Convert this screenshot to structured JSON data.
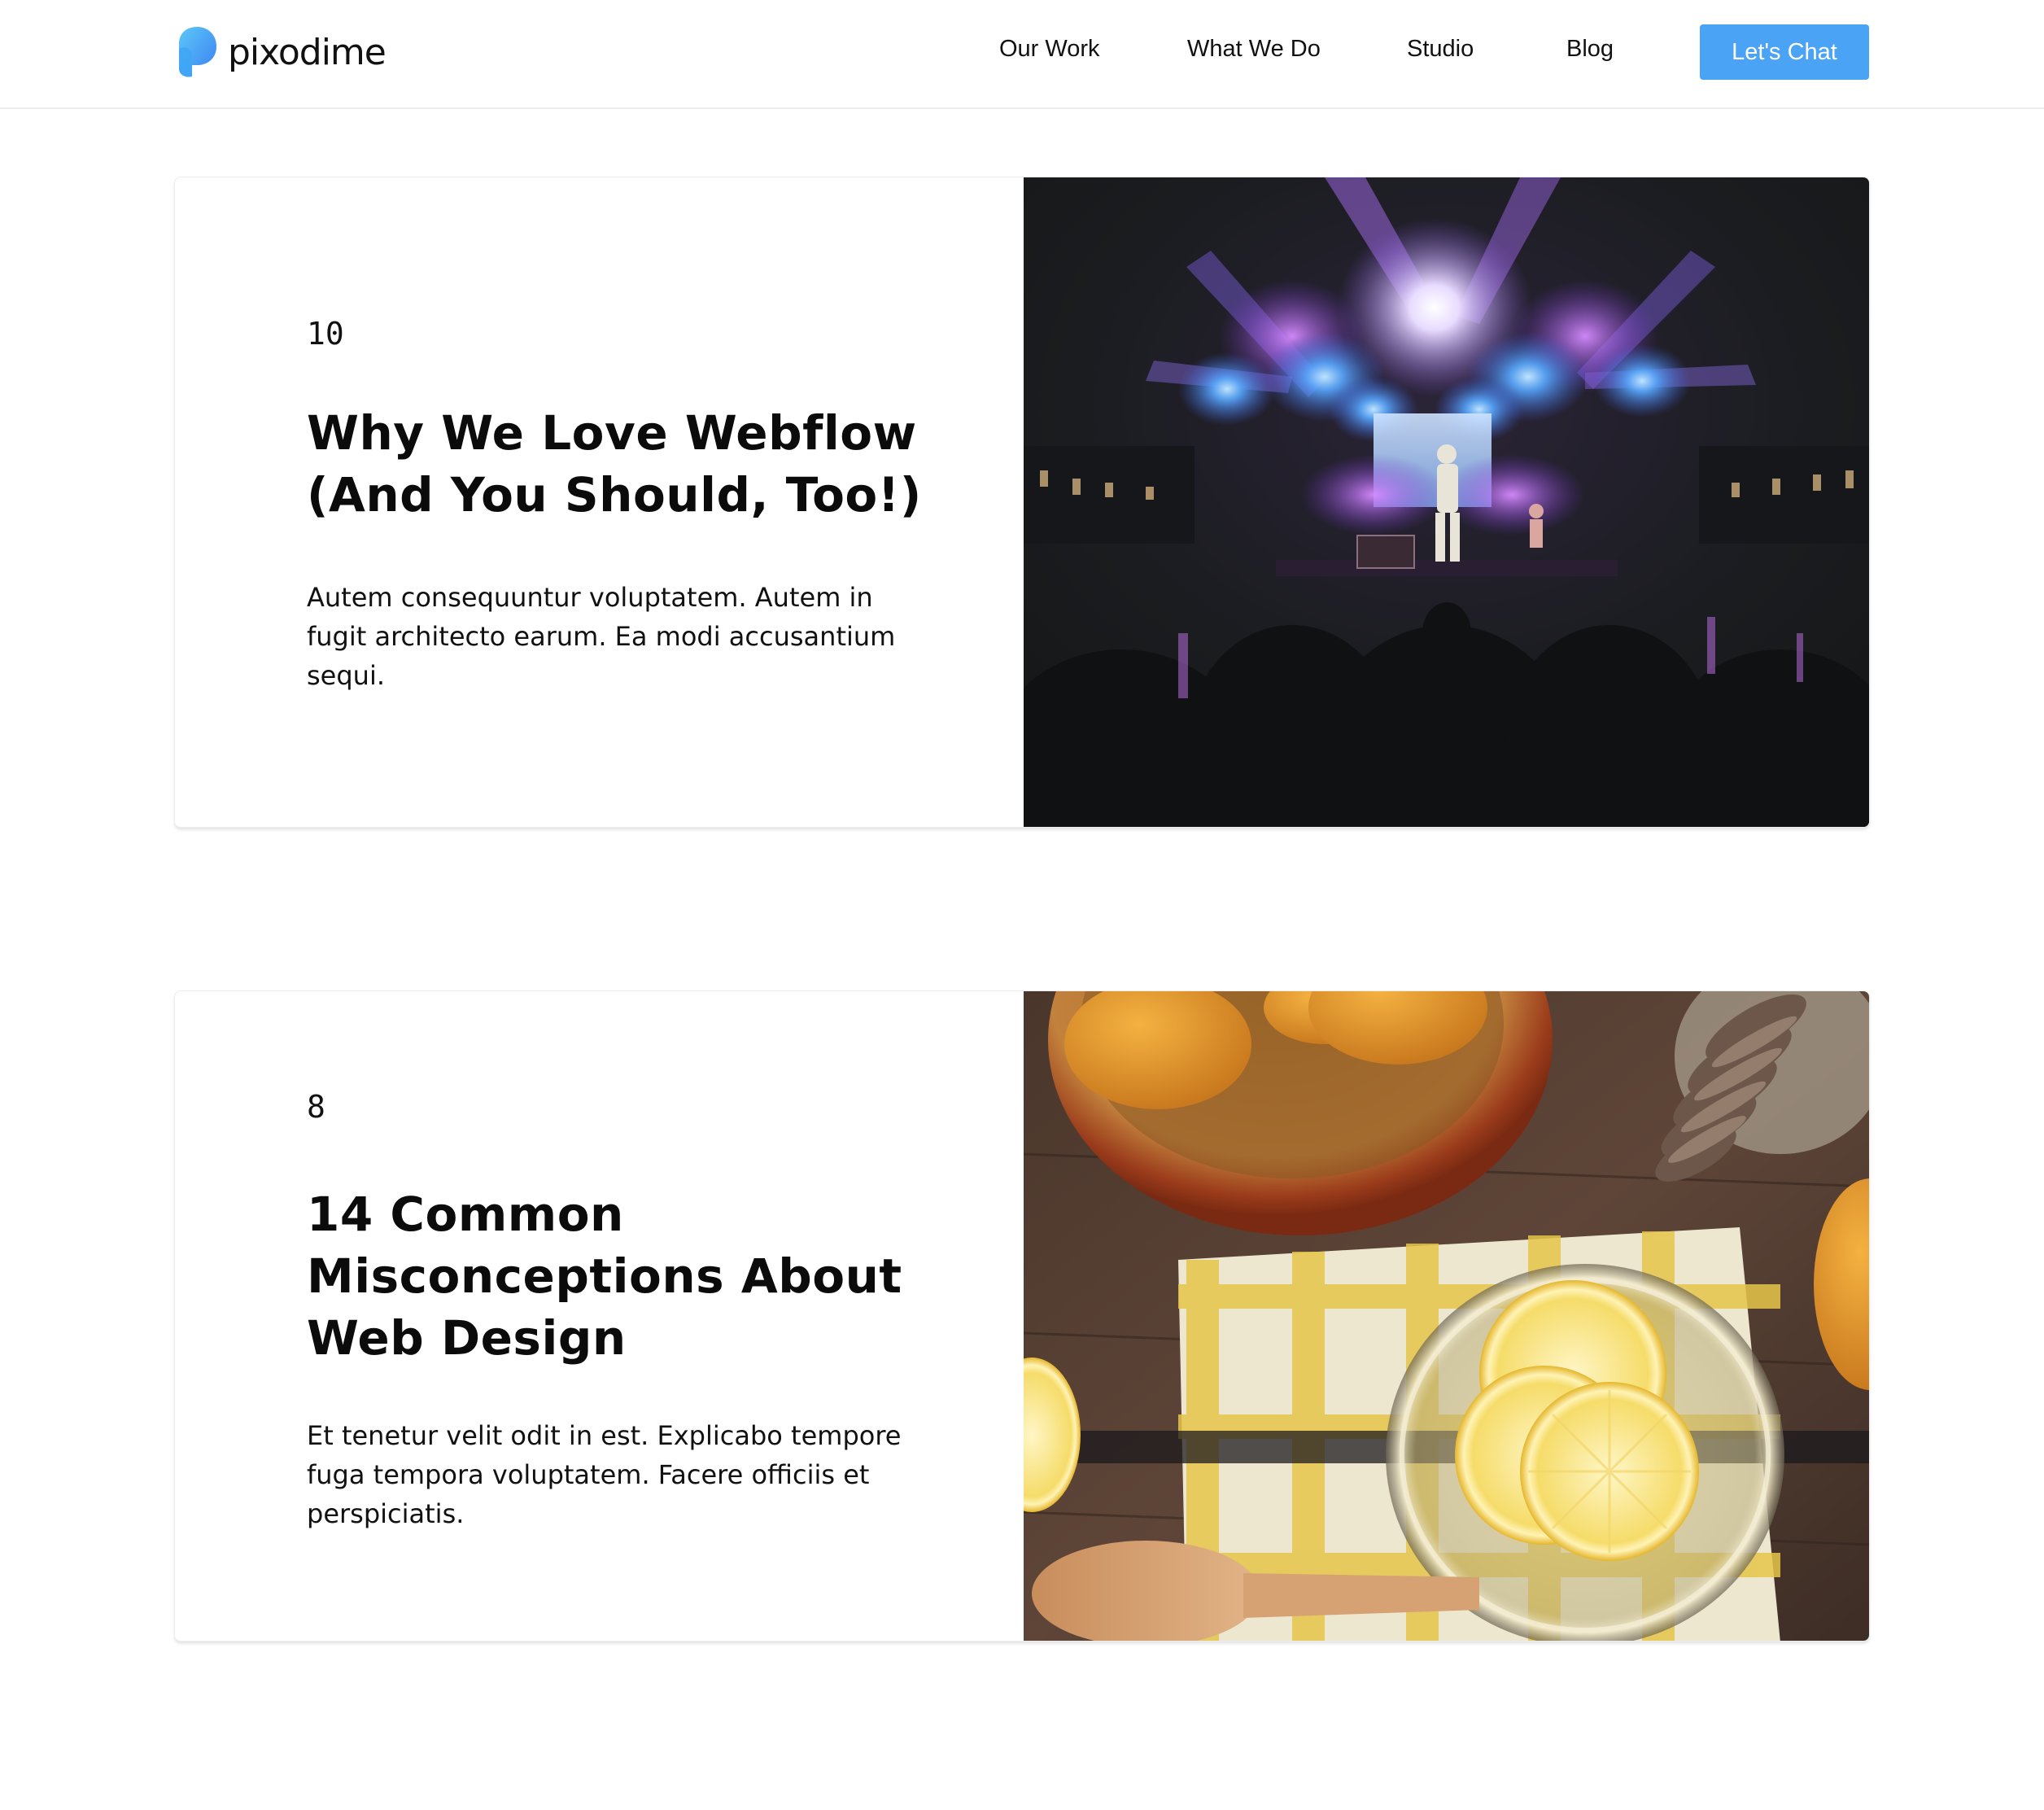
{
  "brand": {
    "name": "pixodime",
    "color_primary": "#3b7ff2",
    "color_secondary": "#5cc8f8"
  },
  "nav": {
    "items": [
      {
        "label": "Our Work"
      },
      {
        "label": "What We Do"
      },
      {
        "label": "Studio"
      },
      {
        "label": "Blog"
      }
    ],
    "cta_label": "Let's Chat",
    "cta_color": "#4aa3f4"
  },
  "posts": [
    {
      "number": "10",
      "title": "Why We Love Webflow (And You Should, Too!)",
      "excerpt": "Autem consequuntur voluptatem. Autem in fugit architecto earum. Ea modi accusantium sequi.",
      "image": "concert-stage-photo"
    },
    {
      "number": "8",
      "title": "14 Common Misconceptions About Web Design",
      "excerpt": "Et tenetur velit odit in est. Explicabo tempore fuga tempora voluptatem. Facere officiis et perspiciatis.",
      "image": "lemon-tea-honey-photo"
    }
  ]
}
